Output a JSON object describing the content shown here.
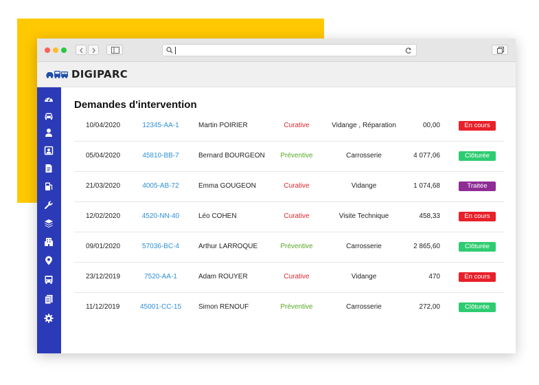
{
  "browser": {
    "address_value": ""
  },
  "app": {
    "brand": "DIGIPARC",
    "logo_icon": "vehicles-logo-icon",
    "colors": {
      "sidebar": "#2b3bb8",
      "background_accent": "#ffc800",
      "curative": "#e0242c",
      "preventive": "#55a622",
      "status_en_cours": "#e8202a",
      "status_cloturee": "#2ecc71",
      "status_traitee": "#8e2c96",
      "link": "#2c8fd6"
    }
  },
  "sidebar": {
    "items": [
      {
        "icon": "dashboard-icon"
      },
      {
        "icon": "car-icon"
      },
      {
        "icon": "user-icon"
      },
      {
        "icon": "driver-badge-icon"
      },
      {
        "icon": "document-icon"
      },
      {
        "icon": "fuel-icon"
      },
      {
        "icon": "wrench-icon"
      },
      {
        "icon": "layers-icon"
      },
      {
        "icon": "building-icon"
      },
      {
        "icon": "map-pin-icon"
      },
      {
        "icon": "bus-icon"
      },
      {
        "icon": "documents-icon"
      },
      {
        "icon": "gear-icon"
      }
    ]
  },
  "main": {
    "title": "Demandes d'intervention",
    "rows": [
      {
        "date": "10/04/2020",
        "plate": "12345-AA-1",
        "name": "Martin POIRIER",
        "type": "Curative",
        "type_kind": "curative",
        "service": "Vidange , Réparation",
        "amount": "00,00",
        "status": "En cours",
        "status_kind": "en-cours"
      },
      {
        "date": "05/04/2020",
        "plate": "45810-BB-7",
        "name": "Bernard BOURGEON",
        "type": "Préventive",
        "type_kind": "preventive",
        "service": "Carrosserie",
        "amount": "4 077,06",
        "status": "Clôturée",
        "status_kind": "cloturee"
      },
      {
        "date": "21/03/2020",
        "plate": "4005-AB-72",
        "name": "Emma GOUGEON",
        "type": "Curative",
        "type_kind": "curative",
        "service": "Vidange",
        "amount": "1 074,68",
        "status": "Traitée",
        "status_kind": "traitee"
      },
      {
        "date": "12/02/2020",
        "plate": "4520-NN-40",
        "name": "Léo COHEN",
        "type": "Curative",
        "type_kind": "curative",
        "service": "Visite Technique",
        "amount": "458,33",
        "status": "En cours",
        "status_kind": "en-cours"
      },
      {
        "date": "09/01/2020",
        "plate": "57036-BC-4",
        "name": "Arthur LARROQUE",
        "type": "Préventive",
        "type_kind": "preventive",
        "service": "Carrosserie",
        "amount": "2 865,60",
        "status": "Clôturée",
        "status_kind": "cloturee"
      },
      {
        "date": "23/12/2019",
        "plate": "7520-AA-1",
        "name": "Adam ROUYER",
        "type": "Curative",
        "type_kind": "curative",
        "service": "Vidange",
        "amount": "470",
        "status": "En cours",
        "status_kind": "en-cours"
      },
      {
        "date": "11/12/2019",
        "plate": "45001-CC-15",
        "name": "Simon RENOUF",
        "type": "Préventive",
        "type_kind": "preventive",
        "service": "Carrosserie",
        "amount": "272,00",
        "status": "Clôturée",
        "status_kind": "cloturee"
      }
    ]
  }
}
